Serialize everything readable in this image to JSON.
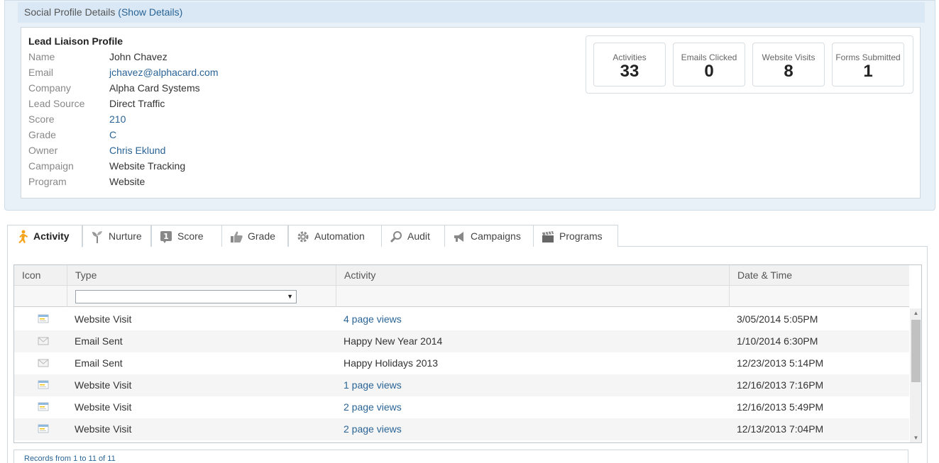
{
  "profile": {
    "header_title": "Social Profile Details",
    "header_link": "(Show Details)",
    "lead_title": "Lead Liaison Profile",
    "fields": [
      {
        "label": "Name",
        "value": "John Chavez"
      },
      {
        "label": "Email",
        "value": "jchavez@alphacard.com"
      },
      {
        "label": "Company",
        "value": "Alpha Card Systems"
      },
      {
        "label": "Lead Source",
        "value": "Direct Traffic"
      },
      {
        "label": "Score",
        "value": "210"
      },
      {
        "label": "Grade",
        "value": "C"
      },
      {
        "label": "Owner",
        "value": "Chris Eklund"
      },
      {
        "label": "Campaign",
        "value": "Website Tracking"
      },
      {
        "label": "Program",
        "value": "Website"
      }
    ],
    "stats": [
      {
        "label": "Activities",
        "value": "33"
      },
      {
        "label": "Emails Clicked",
        "value": "0"
      },
      {
        "label": "Website Visits",
        "value": "8"
      },
      {
        "label": "Forms Submitted",
        "value": "1"
      }
    ]
  },
  "tabs": [
    {
      "label": "Activity",
      "icon": "runner-icon",
      "active": true
    },
    {
      "label": "Nurture",
      "icon": "sprout-icon"
    },
    {
      "label": "Score",
      "icon": "score-badge-icon"
    },
    {
      "label": "Grade",
      "icon": "thumbs-up-icon"
    },
    {
      "label": "Automation",
      "icon": "gear-icon"
    },
    {
      "label": "Audit",
      "icon": "magnifier-icon"
    },
    {
      "label": "Campaigns",
      "icon": "megaphone-icon"
    },
    {
      "label": "Programs",
      "icon": "clapperboard-icon"
    }
  ],
  "grid": {
    "columns": [
      "Icon",
      "Type",
      "Activity",
      "Date & Time"
    ],
    "type_filter_value": "",
    "rows": [
      {
        "icon": "website-visit-icon",
        "type": "Website Visit",
        "activity": "4 page views",
        "date": "3/05/2014 5:05PM"
      },
      {
        "icon": "email-sent-icon",
        "type": "Email Sent",
        "activity": "Happy New Year 2014",
        "date": "1/10/2014 6:30PM"
      },
      {
        "icon": "email-sent-icon",
        "type": "Email Sent",
        "activity": "Happy Holidays 2013",
        "date": "12/23/2013 5:14PM"
      },
      {
        "icon": "website-visit-icon",
        "type": "Website Visit",
        "activity": "1 page views",
        "date": "12/16/2013 7:16PM"
      },
      {
        "icon": "website-visit-icon",
        "type": "Website Visit",
        "activity": "2 page views",
        "date": "12/16/2013 5:49PM"
      },
      {
        "icon": "website-visit-icon",
        "type": "Website Visit",
        "activity": "2 page views",
        "date": "12/13/2013 7:04PM"
      }
    ],
    "records_prefix": "Records from",
    "records_from": "1",
    "records_to_word": "to",
    "records_to": "11",
    "records_of_word": "of",
    "records_total": "11"
  },
  "colors": {
    "link": "#2a6496",
    "panel_bg": "#e9f1f8",
    "header_bg": "#d9e8f4",
    "activity_icon": "#f5a31a"
  }
}
